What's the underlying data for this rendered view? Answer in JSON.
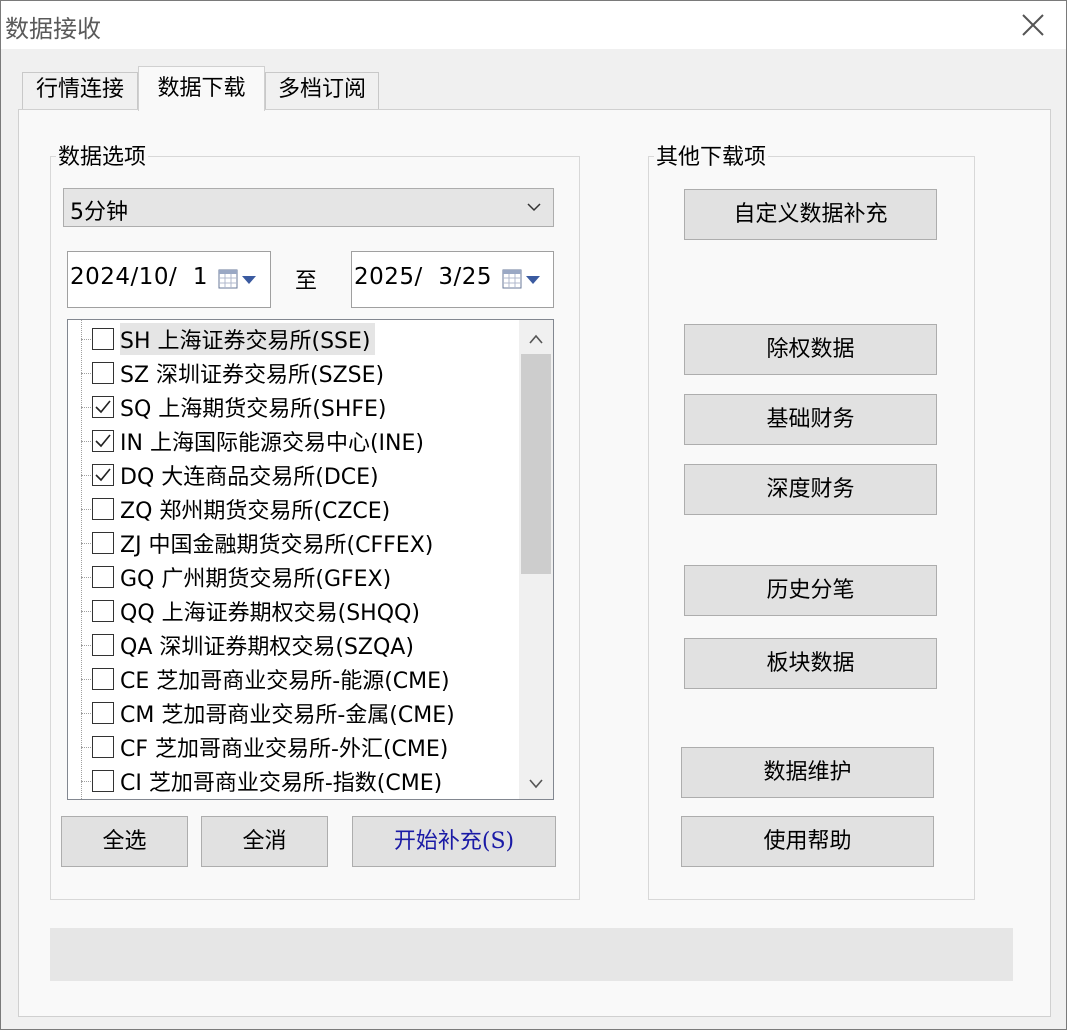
{
  "window": {
    "title": "数据接收"
  },
  "tabs": [
    {
      "label": "行情连接"
    },
    {
      "label": "数据下载"
    },
    {
      "label": "多档订阅"
    }
  ],
  "data_options": {
    "group_label": "数据选项",
    "period_selected": "5分钟",
    "start_date": "2024/10/  1",
    "to_label": "至",
    "end_date": "2025/  3/25",
    "exchanges": [
      {
        "label": "SH 上海证券交易所(SSE)",
        "checked": false
      },
      {
        "label": "SZ 深圳证券交易所(SZSE)",
        "checked": false
      },
      {
        "label": "SQ 上海期货交易所(SHFE)",
        "checked": true
      },
      {
        "label": "IN 上海国际能源交易中心(INE)",
        "checked": true
      },
      {
        "label": "DQ 大连商品交易所(DCE)",
        "checked": true
      },
      {
        "label": "ZQ 郑州期货交易所(CZCE)",
        "checked": false
      },
      {
        "label": "ZJ 中国金融期货交易所(CFFEX)",
        "checked": false
      },
      {
        "label": "GQ 广州期货交易所(GFEX)",
        "checked": false
      },
      {
        "label": "QQ 上海证券期权交易(SHQQ)",
        "checked": false
      },
      {
        "label": "QA 深圳证券期权交易(SZQA)",
        "checked": false
      },
      {
        "label": "CE 芝加哥商业交易所-能源(CME)",
        "checked": false
      },
      {
        "label": "CM 芝加哥商业交易所-金属(CME)",
        "checked": false
      },
      {
        "label": "CF 芝加哥商业交易所-外汇(CME)",
        "checked": false
      },
      {
        "label": "CI 芝加哥商业交易所-指数(CME)",
        "checked": false
      }
    ],
    "select_all": "全选",
    "deselect_all": "全消",
    "start_fill": "开始补充(S)"
  },
  "other_downloads": {
    "group_label": "其他下载项",
    "buttons": {
      "custom_fill": "自定义数据补充",
      "ex_rights": "除权数据",
      "basic_finance": "基础财务",
      "deep_finance": "深度财务",
      "tick_history": "历史分笔",
      "sector_data": "板块数据",
      "maintenance": "数据维护",
      "help": "使用帮助"
    }
  },
  "colors": {
    "accent_text": "#1a1aa6",
    "button_bg": "#e1e1e1"
  }
}
